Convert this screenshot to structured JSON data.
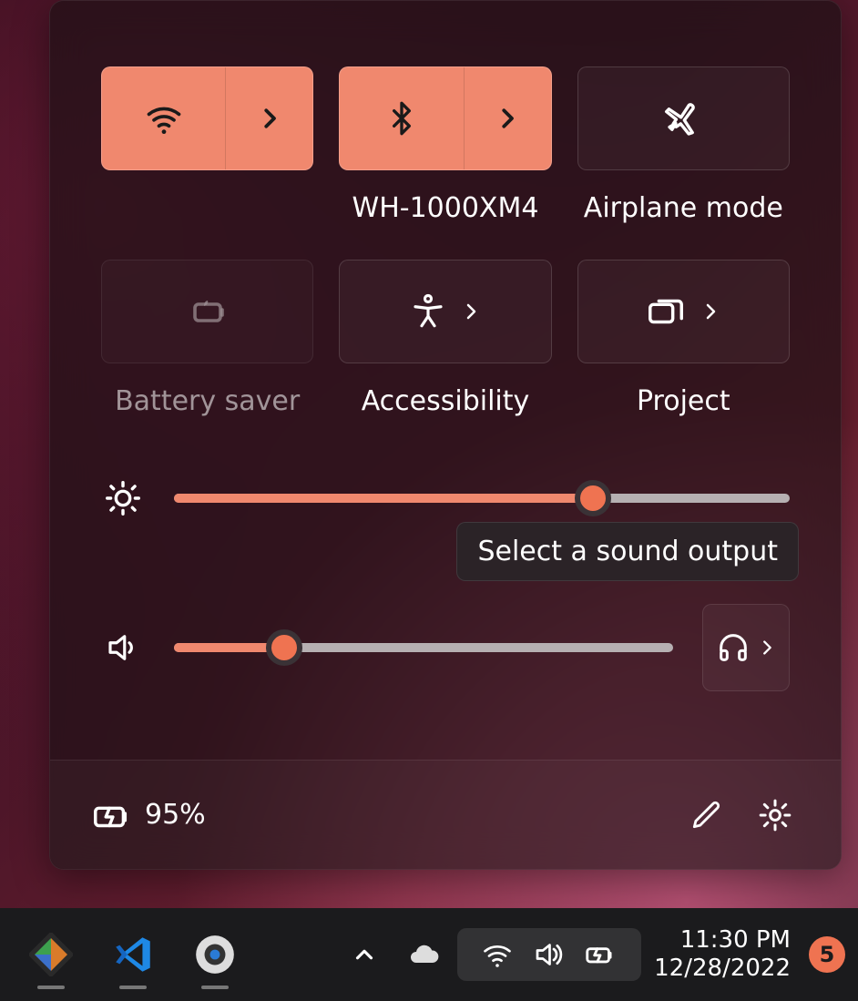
{
  "tiles": {
    "wifi": {
      "label": ""
    },
    "bluetooth": {
      "label": "WH-1000XM4"
    },
    "airplane": {
      "label": "Airplane mode"
    },
    "battery_saver": {
      "label": "Battery saver"
    },
    "accessibility": {
      "label": "Accessibility"
    },
    "project": {
      "label": "Project"
    }
  },
  "sliders": {
    "brightness_percent": 68,
    "volume_percent": 22
  },
  "tooltip": {
    "sound_output": "Select a sound output"
  },
  "panel_footer": {
    "battery_text": "95%"
  },
  "taskbar": {
    "time": "11:30 PM",
    "date": "12/28/2022",
    "notification_count": "5"
  }
}
